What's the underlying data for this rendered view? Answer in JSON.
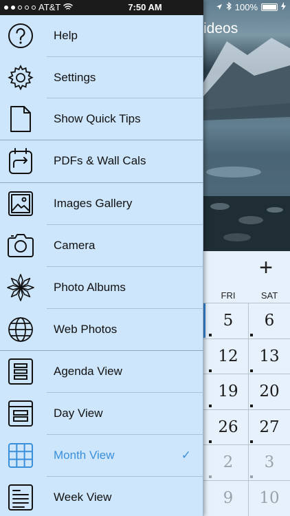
{
  "status_bar": {
    "carrier": "AT&T",
    "time": "7:50 AM",
    "battery": "100%"
  },
  "background": {
    "photo_title": "ideos",
    "add_icon": "plus-icon",
    "weekdays": [
      "FRI",
      "SAT"
    ],
    "days": [
      {
        "fri": "5",
        "sat": "6"
      },
      {
        "fri": "12",
        "sat": "13"
      },
      {
        "fri": "19",
        "sat": "20"
      },
      {
        "fri": "26",
        "sat": "27"
      },
      {
        "fri": "2",
        "sat": "3"
      },
      {
        "fri": "9",
        "sat": "10"
      }
    ]
  },
  "menu": {
    "items": [
      {
        "label": "Help",
        "icon": "help-icon"
      },
      {
        "label": "Settings",
        "icon": "gear-icon"
      },
      {
        "label": "Show Quick Tips",
        "icon": "document-icon"
      },
      {
        "label": "PDFs & Wall Cals",
        "icon": "export-icon"
      },
      {
        "label": "Images Gallery",
        "icon": "image-icon"
      },
      {
        "label": "Camera",
        "icon": "camera-icon"
      },
      {
        "label": "Photo Albums",
        "icon": "flower-icon"
      },
      {
        "label": "Web Photos",
        "icon": "globe-icon"
      },
      {
        "label": "Agenda View",
        "icon": "agenda-icon"
      },
      {
        "label": "Day View",
        "icon": "day-view-icon"
      },
      {
        "label": "Month View",
        "icon": "grid-icon",
        "selected": true
      },
      {
        "label": "Week View",
        "icon": "week-view-icon"
      }
    ]
  },
  "colors": {
    "drawer_bg": "#cde6fb",
    "accent": "#3a8fdb",
    "calendar_bg": "#e6f1fb"
  }
}
